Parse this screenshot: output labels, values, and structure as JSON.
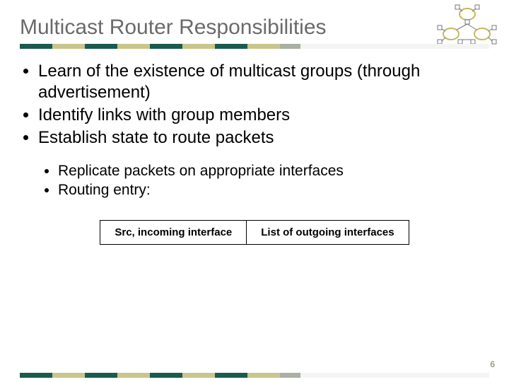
{
  "title": "Multicast Router Responsibilities",
  "bullets": {
    "b0": "Learn of the existence of multicast groups (through advertisement)",
    "b1": "Identify links with group members",
    "b2": "Establish state to route packets"
  },
  "subbullets": {
    "s0": "Replicate packets on appropriate interfaces",
    "s1": "Routing entry:"
  },
  "table": {
    "c0": "Src, incoming interface",
    "c1": "List of outgoing interfaces"
  },
  "pageNumber": "6"
}
